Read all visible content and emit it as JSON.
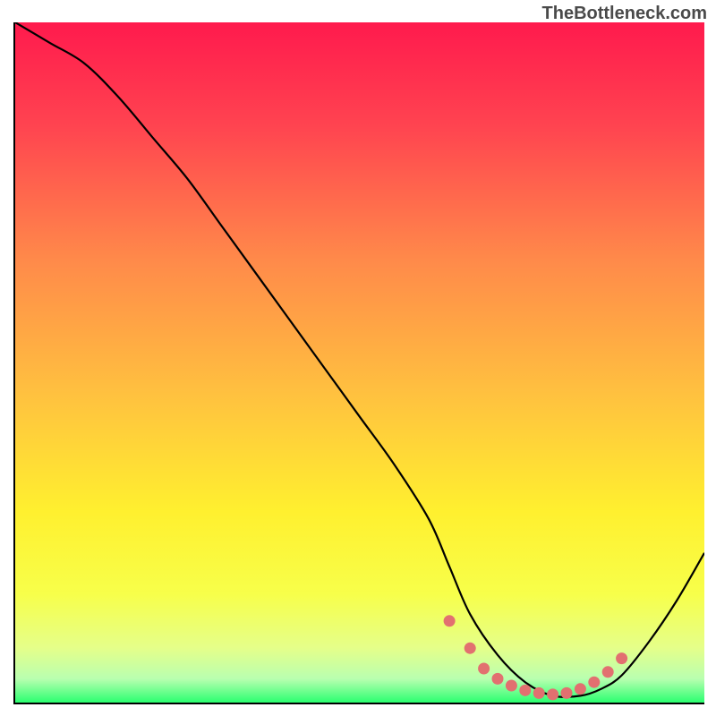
{
  "watermark": "TheBottleneck.com",
  "chart_data": {
    "type": "line",
    "title": "",
    "xlabel": "",
    "ylabel": "",
    "xlim": [
      0,
      100
    ],
    "ylim": [
      0,
      100
    ],
    "series": [
      {
        "name": "curve",
        "x": [
          0,
          5,
          10,
          15,
          20,
          25,
          30,
          35,
          40,
          45,
          50,
          55,
          60,
          63,
          66,
          70,
          74,
          78,
          82,
          85,
          88,
          92,
          96,
          100
        ],
        "y": [
          100,
          97,
          94,
          89,
          83,
          77,
          70,
          63,
          56,
          49,
          42,
          35,
          27,
          20,
          13,
          7,
          3,
          1,
          1,
          2,
          4,
          9,
          15,
          22
        ]
      }
    ],
    "markers": {
      "name": "highlight-dots",
      "color": "#e27070",
      "x": [
        63,
        66,
        68,
        70,
        72,
        74,
        76,
        78,
        80,
        82,
        84,
        86,
        88
      ],
      "y": [
        12,
        8,
        5,
        3.5,
        2.5,
        1.8,
        1.4,
        1.2,
        1.4,
        2,
        3,
        4.5,
        6.5
      ]
    },
    "gradient_bg": {
      "stops": [
        {
          "offset": 0.0,
          "color": "#ff1a4d"
        },
        {
          "offset": 0.15,
          "color": "#ff4350"
        },
        {
          "offset": 0.35,
          "color": "#ff8a4a"
        },
        {
          "offset": 0.55,
          "color": "#ffc23f"
        },
        {
          "offset": 0.72,
          "color": "#fff02f"
        },
        {
          "offset": 0.84,
          "color": "#f7ff4a"
        },
        {
          "offset": 0.92,
          "color": "#e5ff8a"
        },
        {
          "offset": 0.965,
          "color": "#b9ffb0"
        },
        {
          "offset": 1.0,
          "color": "#2bff70"
        }
      ]
    }
  }
}
